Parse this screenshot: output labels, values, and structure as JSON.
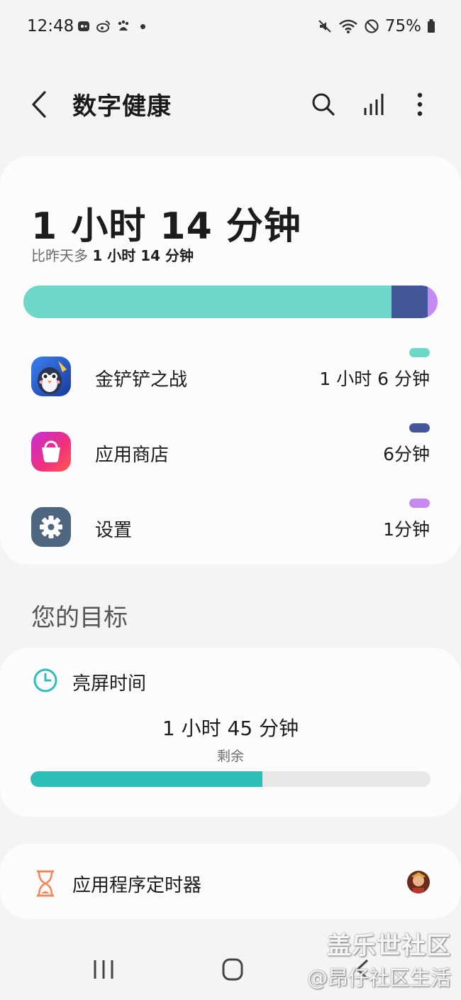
{
  "status_bar": {
    "time": "12:48",
    "battery": "75%",
    "left_icons": [
      "app-notification-icon",
      "weibo-icon",
      "baidu-icon",
      "dot-icon"
    ],
    "right_icons": [
      "mute-icon",
      "wifi-icon",
      "do-not-disturb-icon",
      "battery-icon"
    ]
  },
  "header": {
    "title": "数字健康",
    "actions": [
      "search-icon",
      "chart-icon",
      "more-icon"
    ]
  },
  "usage": {
    "total_time": "1 小时 14 分钟",
    "compare_prefix": "比昨天多 ",
    "compare_value": "1 小时 14 分钟",
    "bar_segments": [
      {
        "color": "#6dd8c8",
        "fraction": 0.888
      },
      {
        "color": "#44579a",
        "fraction": 0.088
      },
      {
        "color": "#c48af0",
        "fraction": 0.024
      }
    ],
    "apps": [
      {
        "name": "金铲铲之战",
        "time": "1 小时 6 分钟",
        "color": "#6dd8c8",
        "icon": "game-penguin-icon"
      },
      {
        "name": "应用商店",
        "time": "6分钟",
        "color": "#44579a",
        "icon": "store-bag-icon"
      },
      {
        "name": "设置",
        "time": "1分钟",
        "color": "#c48af0",
        "icon": "settings-gear-icon"
      }
    ]
  },
  "goals": {
    "section_title": "您的目标",
    "screen_time": {
      "label": "亮屏时间",
      "remaining": "1 小时 45 分钟",
      "remaining_label": "剩余",
      "progress_fraction": 0.58,
      "color": "#2ebeb9"
    }
  },
  "app_timer": {
    "label": "应用程序定时器"
  },
  "watermark": {
    "line1": "盖乐世社区",
    "line2": "@昂仔社区生活"
  }
}
